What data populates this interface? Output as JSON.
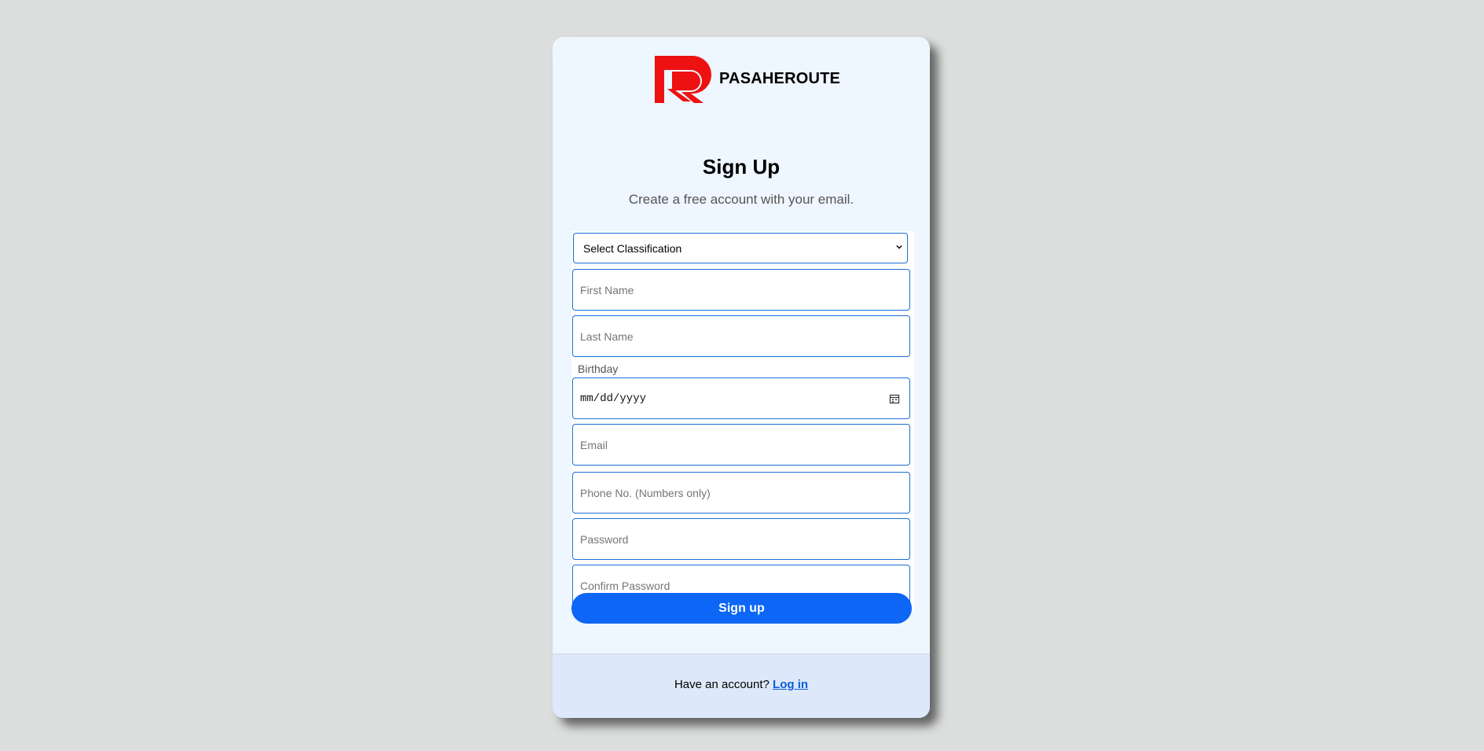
{
  "brand": {
    "name": "PASAHEROUTE",
    "logo_icon": "r-logo-icon",
    "logo_color": "#ee1111"
  },
  "header": {
    "title": "Sign Up",
    "subtitle": "Create a free account with your email."
  },
  "form": {
    "classification": {
      "selected": "Select Classification"
    },
    "first_name_placeholder": "First Name",
    "last_name_placeholder": "Last Name",
    "birthday_label": "Birthday",
    "birthday_placeholder": "mm/dd/yyyy",
    "email_placeholder": "Email",
    "phone_placeholder": "Phone No. (Numbers only)",
    "password_placeholder": "Password",
    "confirm_password_placeholder": "Confirm Password"
  },
  "actions": {
    "signup_label": "Sign up"
  },
  "footer": {
    "prompt": "Have an account?",
    "login_label": "Log in"
  },
  "colors": {
    "accent": "#0d66f5",
    "field_border": "#1a6fd6",
    "card_bg": "#eef6ff",
    "footer_bg": "#dde9fa",
    "page_bg": "#dcdedd"
  }
}
